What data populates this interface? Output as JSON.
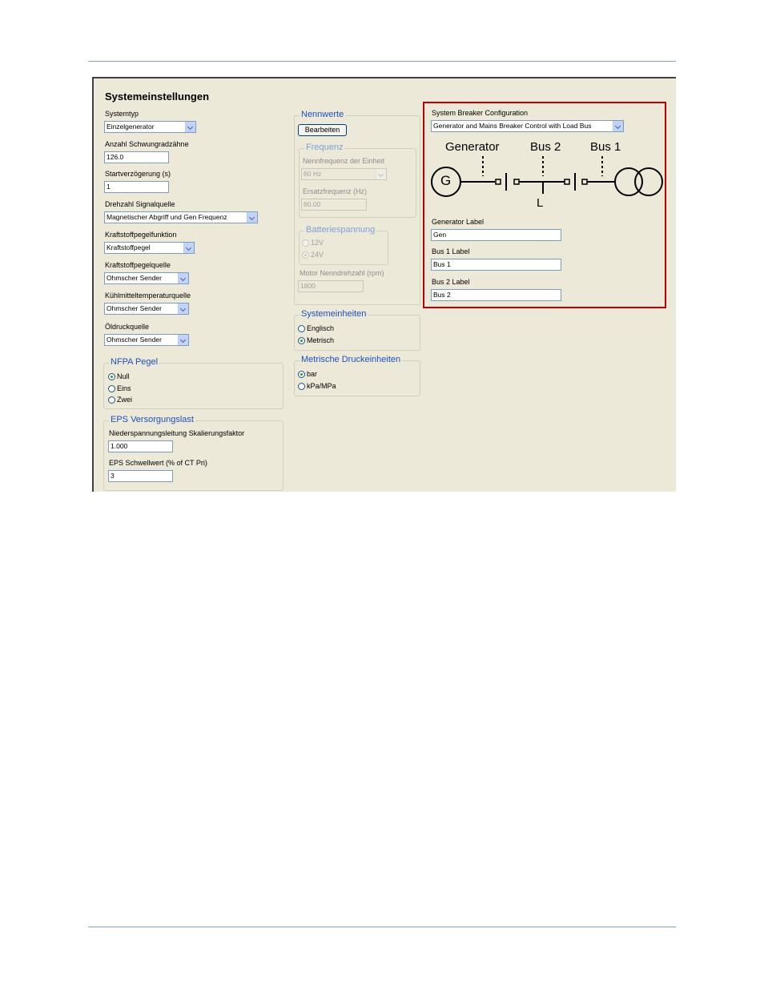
{
  "panel": {
    "title": "Systemeinstellungen"
  },
  "left": {
    "systemtyp": {
      "label": "Systemtyp",
      "value": "Einzelgenerator"
    },
    "schwungrad": {
      "label": "Anzahl Schwungradzähne",
      "value": "126.0"
    },
    "startverzoegerung": {
      "label": "Startverzögerung (s)",
      "value": "1"
    },
    "drehzahl": {
      "label": "Drehzahl Signalquelle",
      "value": "Magnetischer Abgriff und Gen Frequenz"
    },
    "kraftstoffpegelfunktion": {
      "label": "Kraftstoffpegelfunktion",
      "value": "Kraftstoffpegel"
    },
    "kraftstoffpegelquelle": {
      "label": "Kraftstoffpegelquelle",
      "value": "Ohmscher Sender"
    },
    "kuehlmittel": {
      "label": "Kühlmitteltemperaturquelle",
      "value": "Ohmscher Sender"
    },
    "oeldruck": {
      "label": "Öldruckquelle",
      "value": "Ohmscher Sender"
    },
    "nfpa": {
      "title": "NFPA Pegel",
      "options": [
        "Null",
        "Eins",
        "Zwei"
      ],
      "selected": 0
    },
    "eps": {
      "title": "EPS Versorgungslast",
      "factor_label": "Niederspannungsleitung Skalierungsfaktor",
      "factor_value": "1.000",
      "threshold_label": "EPS Schwellwert (% of CT Pri)",
      "threshold_value": "3"
    }
  },
  "middle": {
    "nennwerte": {
      "title": "Nennwerte",
      "button": "Bearbeiten"
    },
    "frequenz": {
      "title": "Frequenz",
      "nenn_label": "Nennfrequenz der Einheit",
      "nenn_value": "60 Hz",
      "ersatz_label": "Ersatzfrequenz (Hz)",
      "ersatz_value": "60.00"
    },
    "batterie": {
      "title": "Batteriespannung",
      "options": [
        "12V",
        "24V"
      ],
      "selected": 1
    },
    "motor": {
      "label": "Motor Nenndrehzahl (rpm)",
      "value": "1800"
    },
    "systemeinheiten": {
      "title": "Systemeinheiten",
      "options": [
        "Englisch",
        "Metrisch"
      ],
      "selected": 1
    },
    "druck": {
      "title": "Metrische Druckeinheiten",
      "options": [
        "bar",
        "kPa/MPa"
      ],
      "selected": 0
    }
  },
  "breaker": {
    "config_label": "System Breaker Configuration",
    "config_value": "Generator and Mains Breaker Control with Load Bus",
    "diagram": {
      "generator": "Generator",
      "bus2": "Bus 2",
      "bus1": "Bus 1",
      "g": "G",
      "load": "L"
    },
    "gen_label": {
      "label": "Generator Label",
      "value": "Gen"
    },
    "bus1_label": {
      "label": "Bus 1 Label",
      "value": "Bus 1"
    },
    "bus2_label": {
      "label": "Bus 2 Label",
      "value": "Bus 2"
    },
    "highlight_color": "#c00000"
  }
}
